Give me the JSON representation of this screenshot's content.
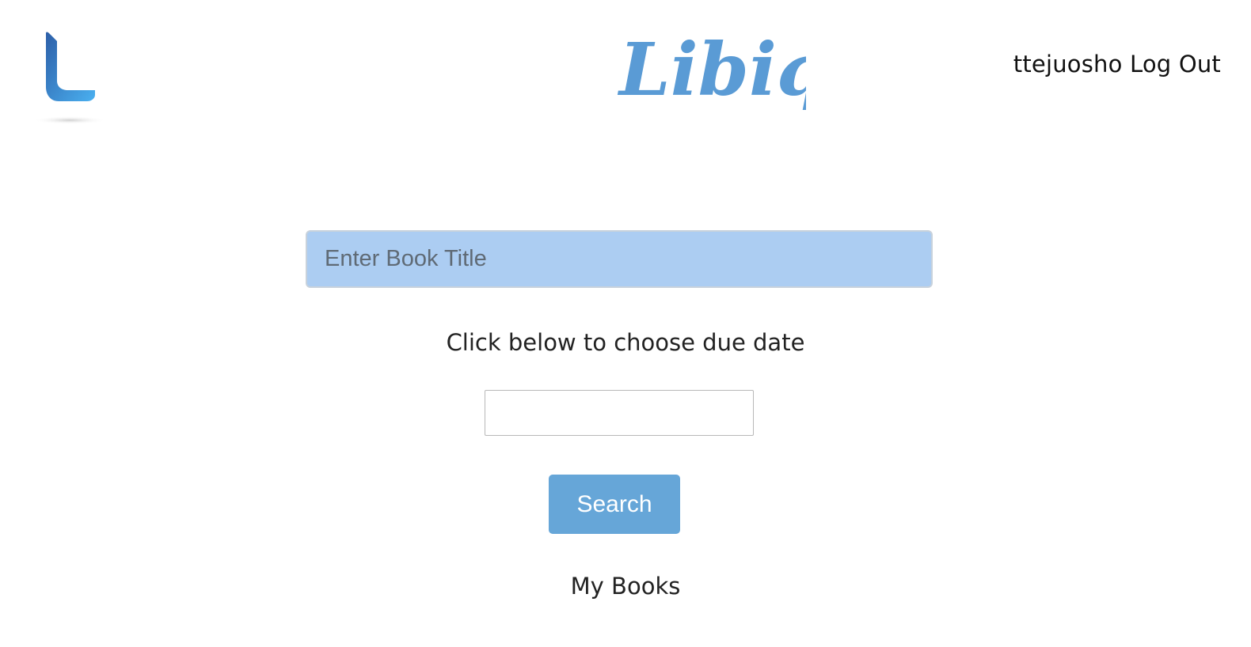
{
  "header": {
    "logo_icon": "libiq-l-mark-icon",
    "brand_name": "Libiq",
    "brand_color": "#5a9bd5",
    "username": "ttejuosho",
    "logout_label": "Log Out"
  },
  "search": {
    "title_placeholder": "Enter Book Title",
    "title_value": "",
    "due_date_prompt": "Click below to choose due date",
    "due_date_value": "",
    "search_label": "Search",
    "input_bg_color": "#accdf2",
    "button_color": "#66a6d8"
  },
  "sections": {
    "my_books_label": "My Books"
  }
}
